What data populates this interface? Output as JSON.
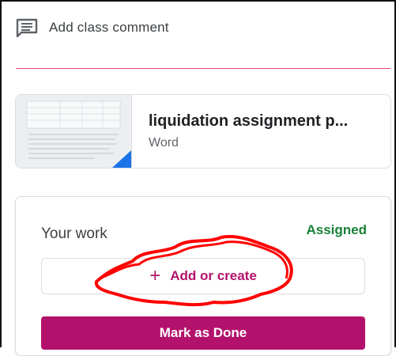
{
  "comment": {
    "label": "Add class comment",
    "icon": "comment-icon",
    "underline_color": "#e0457b"
  },
  "attachment": {
    "title": "liquidation assignment p...",
    "type": "Word"
  },
  "your_work": {
    "title": "Your work",
    "status": "Assigned",
    "status_color": "#188038",
    "add_label": "Add or create",
    "done_label": "Mark as Done",
    "accent_color": "#b3126c"
  }
}
